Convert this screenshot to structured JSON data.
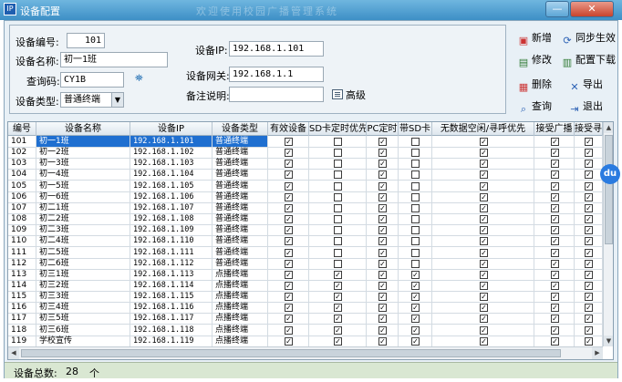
{
  "window": {
    "title": "设备配置",
    "background_title": "欢迎使用校园广播管理系统",
    "app_icon_label": "IP",
    "min_label": "—",
    "close_label": "✕"
  },
  "form": {
    "device_no_label": "设备编号:",
    "device_no_value": "101",
    "device_name_label": "设备名称:",
    "device_name_value": "初一1班",
    "query_code_label": "查询码:",
    "query_code_value": "CY1B",
    "device_type_label": "设备类型:",
    "device_type_value": "普通终端",
    "device_ip_label": "设备IP:",
    "device_ip_value": "192.168.1.101",
    "gateway_label": "设备网关:",
    "gateway_value": "192.168.1.1",
    "remark_label": "备注说明:",
    "remark_value": "",
    "advanced_label": "高级"
  },
  "actions": {
    "add": "新增",
    "sync": "同步生效",
    "edit": "修改",
    "download": "配置下载",
    "delete": "删除",
    "export": "导出",
    "query": "查询",
    "exit": "退出"
  },
  "table": {
    "columns": [
      "编号",
      "设备名称",
      "设备IP",
      "设备类型",
      "有效设备",
      "SD卡定时优先",
      "PC定时",
      "带SD卡",
      "无数据空闲/寻呼优先",
      "接受广播",
      "接受寻呼"
    ],
    "rows": [
      {
        "no": "101",
        "name": "初一1班",
        "ip": "192.168.1.101",
        "type": "普通终端",
        "checks": [
          1,
          0,
          1,
          0,
          1,
          1,
          1
        ]
      },
      {
        "no": "102",
        "name": "初一2班",
        "ip": "192.168.1.102",
        "type": "普通终端",
        "checks": [
          1,
          0,
          1,
          0,
          1,
          1,
          1
        ]
      },
      {
        "no": "103",
        "name": "初一3班",
        "ip": "192.168.1.103",
        "type": "普通终端",
        "checks": [
          1,
          0,
          1,
          0,
          1,
          1,
          1
        ]
      },
      {
        "no": "104",
        "name": "初一4班",
        "ip": "192.168.1.104",
        "type": "普通终端",
        "checks": [
          1,
          0,
          1,
          0,
          1,
          1,
          1
        ]
      },
      {
        "no": "105",
        "name": "初一5班",
        "ip": "192.168.1.105",
        "type": "普通终端",
        "checks": [
          1,
          0,
          1,
          0,
          1,
          1,
          1
        ]
      },
      {
        "no": "106",
        "name": "初一6班",
        "ip": "192.168.1.106",
        "type": "普通终端",
        "checks": [
          1,
          0,
          1,
          0,
          1,
          1,
          1
        ]
      },
      {
        "no": "107",
        "name": "初二1班",
        "ip": "192.168.1.107",
        "type": "普通终端",
        "checks": [
          1,
          0,
          1,
          0,
          1,
          1,
          1
        ]
      },
      {
        "no": "108",
        "name": "初二2班",
        "ip": "192.168.1.108",
        "type": "普通终端",
        "checks": [
          1,
          0,
          1,
          0,
          1,
          1,
          1
        ]
      },
      {
        "no": "109",
        "name": "初二3班",
        "ip": "192.168.1.109",
        "type": "普通终端",
        "checks": [
          1,
          0,
          1,
          0,
          1,
          1,
          1
        ]
      },
      {
        "no": "110",
        "name": "初二4班",
        "ip": "192.168.1.110",
        "type": "普通终端",
        "checks": [
          1,
          0,
          1,
          0,
          1,
          1,
          1
        ]
      },
      {
        "no": "111",
        "name": "初二5班",
        "ip": "192.168.1.111",
        "type": "普通终端",
        "checks": [
          1,
          0,
          1,
          0,
          1,
          1,
          1
        ]
      },
      {
        "no": "112",
        "name": "初二6班",
        "ip": "192.168.1.112",
        "type": "普通终端",
        "checks": [
          1,
          0,
          1,
          0,
          1,
          1,
          1
        ]
      },
      {
        "no": "113",
        "name": "初三1班",
        "ip": "192.168.1.113",
        "type": "点播终端",
        "checks": [
          1,
          1,
          1,
          1,
          1,
          1,
          1
        ]
      },
      {
        "no": "114",
        "name": "初三2班",
        "ip": "192.168.1.114",
        "type": "点播终端",
        "checks": [
          1,
          1,
          1,
          1,
          1,
          1,
          1
        ]
      },
      {
        "no": "115",
        "name": "初三3班",
        "ip": "192.168.1.115",
        "type": "点播终端",
        "checks": [
          1,
          1,
          1,
          1,
          1,
          1,
          1
        ]
      },
      {
        "no": "116",
        "name": "初三4班",
        "ip": "192.168.1.116",
        "type": "点播终端",
        "checks": [
          1,
          1,
          1,
          1,
          1,
          1,
          1
        ]
      },
      {
        "no": "117",
        "name": "初三5班",
        "ip": "192.168.1.117",
        "type": "点播终端",
        "checks": [
          1,
          1,
          1,
          1,
          1,
          1,
          1
        ]
      },
      {
        "no": "118",
        "name": "初三6班",
        "ip": "192.168.1.118",
        "type": "点播终端",
        "checks": [
          1,
          1,
          1,
          1,
          1,
          1,
          1
        ]
      },
      {
        "no": "119",
        "name": "学校宣传",
        "ip": "192.168.1.119",
        "type": "点播终端",
        "checks": [
          1,
          1,
          1,
          1,
          1,
          1,
          1
        ]
      }
    ]
  },
  "status": {
    "total_label": "设备总数:",
    "total_value": "28",
    "unit": "个"
  },
  "float_badge": "du",
  "colors": {
    "selection": "#1f6fd0",
    "status_bar": "#d9e7d2",
    "titlebar": "#4a9cd0"
  }
}
